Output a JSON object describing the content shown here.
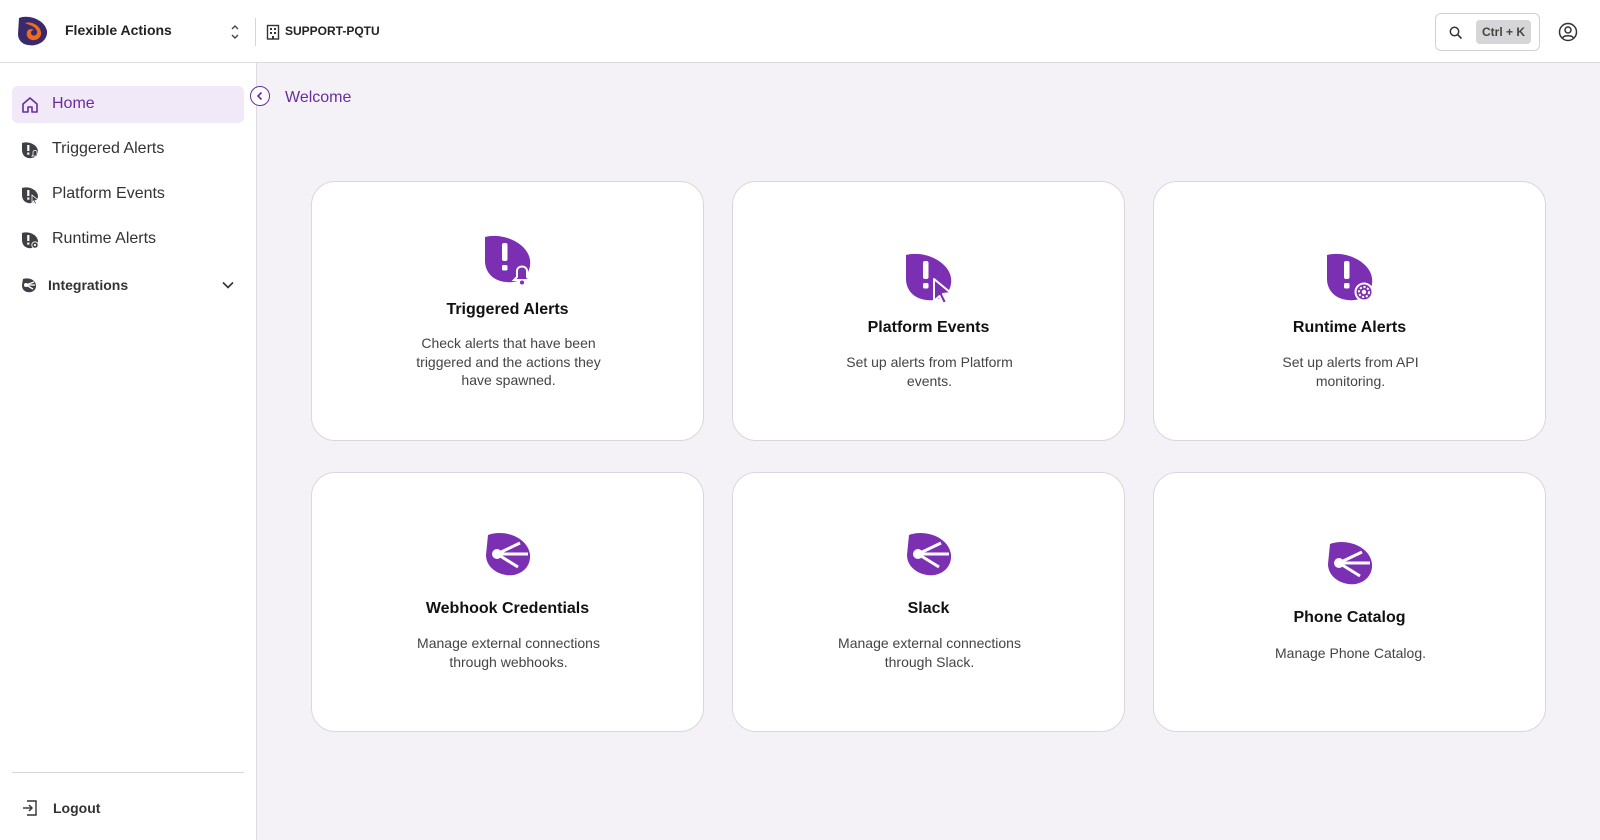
{
  "header": {
    "app_name": "Flexible Actions",
    "org_name": "SUPPORT-PQTU",
    "search_shortcut": "Ctrl + K",
    "brand_color": "#6a2c9e",
    "logo_colors": [
      "#3b2a6b",
      "#f26a1b"
    ]
  },
  "sidebar": {
    "items": [
      {
        "label": "Home",
        "icon": "home-icon",
        "active": true
      },
      {
        "label": "Triggered Alerts",
        "icon": "triggered-alert-icon"
      },
      {
        "label": "Platform Events",
        "icon": "platform-event-icon"
      },
      {
        "label": "Runtime Alerts",
        "icon": "runtime-alert-icon"
      }
    ],
    "group": {
      "label": "Integrations",
      "icon": "integrations-icon",
      "expanded": false
    },
    "logout_label": "Logout"
  },
  "main": {
    "title": "Welcome",
    "cards": [
      {
        "title": "Triggered Alerts",
        "description": "Check alerts that have been triggered and the actions they have spawned.",
        "icon": "alert-bell-icon"
      },
      {
        "title": "Platform Events",
        "description": "Set up alerts from Platform events.",
        "icon": "alert-cursor-icon"
      },
      {
        "title": "Runtime Alerts",
        "description": "Set up alerts from API monitoring.",
        "icon": "alert-gear-icon"
      },
      {
        "title": "Webhook Credentials",
        "description": "Manage external connections through webhooks.",
        "icon": "integration-icon"
      },
      {
        "title": "Slack",
        "description": "Manage external connections through Slack.",
        "icon": "integration-icon"
      },
      {
        "title": "Phone Catalog",
        "description": "Manage Phone Catalog.",
        "icon": "integration-icon"
      }
    ]
  }
}
